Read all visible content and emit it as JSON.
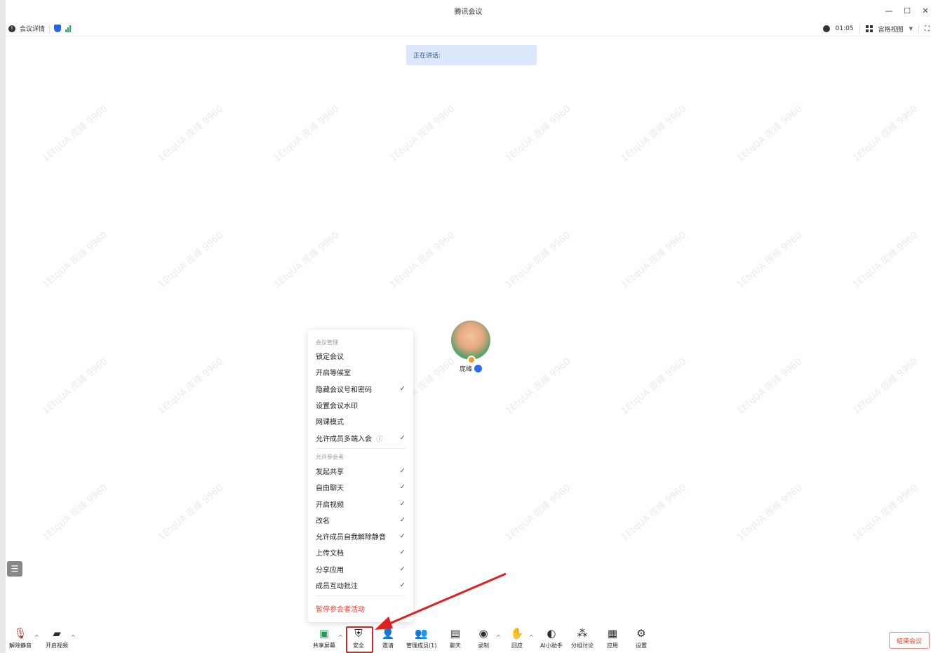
{
  "window": {
    "title": "腾讯会议"
  },
  "infobar": {
    "details_label": "会议详情",
    "timer": "01:05",
    "view_label": "宫格视图"
  },
  "speaking": {
    "label": "正在讲话:"
  },
  "watermark": {
    "text": "1EtqUA 庞峰 9960"
  },
  "participant": {
    "name": "庞峰"
  },
  "security_menu": {
    "section_manage": "会议管理",
    "manage_items": [
      {
        "label": "锁定会议",
        "checked": false
      },
      {
        "label": "开启等候室",
        "checked": false
      },
      {
        "label": "隐藏会议号和密码",
        "checked": true
      },
      {
        "label": "设置会议水印",
        "checked": false
      },
      {
        "label": "网课模式",
        "checked": false
      },
      {
        "label": "允许成员多端入会",
        "checked": true,
        "info": true
      }
    ],
    "section_allow": "允许参会者",
    "allow_items": [
      {
        "label": "发起共享",
        "checked": true
      },
      {
        "label": "自由聊天",
        "checked": true
      },
      {
        "label": "开启视频",
        "checked": true
      },
      {
        "label": "改名",
        "checked": true
      },
      {
        "label": "允许成员自我解除静音",
        "checked": true
      },
      {
        "label": "上传文档",
        "checked": true
      },
      {
        "label": "分享应用",
        "checked": true
      },
      {
        "label": "成员互动批注",
        "checked": true
      }
    ],
    "pause_label": "暂停参会者活动"
  },
  "toolbar": {
    "unmute": "解除静音",
    "start_video": "开启视频",
    "share_screen": "共享屏幕",
    "security": "安全",
    "invite": "邀请",
    "manage_members": "管理成员(1)",
    "chat": "聊天",
    "record": "录制",
    "reactions": "回应",
    "ai_assistant": "AI小助手",
    "breakout": "分组讨论",
    "apps": "应用",
    "settings": "设置",
    "end_meeting": "结束会议"
  },
  "colors": {
    "accent": "#2266ee",
    "danger": "#e0463a",
    "speaking_bg": "#dbe8fb",
    "highlight": "#e02020"
  }
}
